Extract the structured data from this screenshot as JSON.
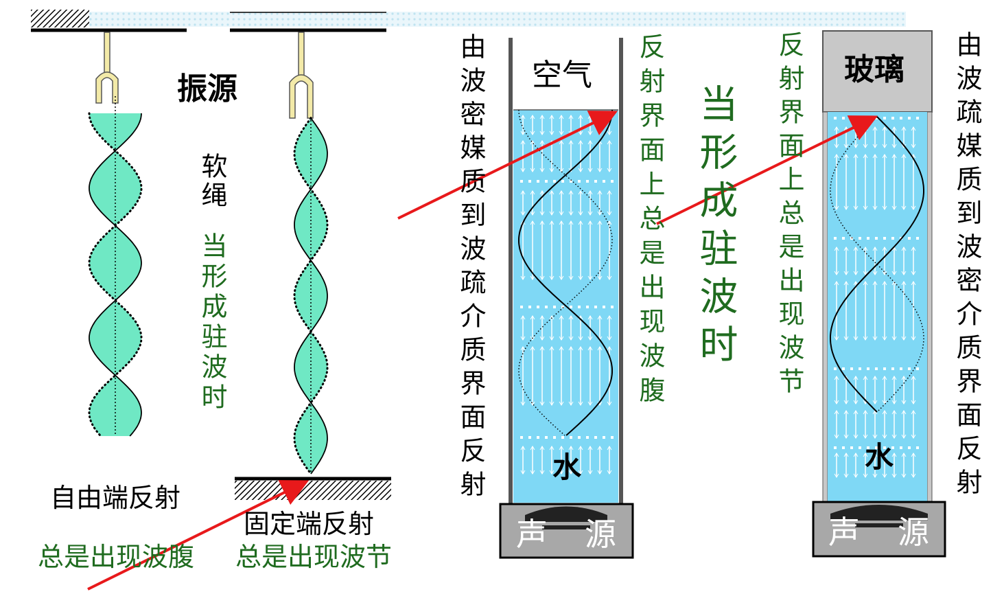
{
  "left_panel": {
    "source_label": "振源",
    "rope_label": "软绳",
    "standing_wave_note": "当形成驻波时",
    "free_end_label": "自由端反射",
    "free_end_result": "总是出现波腹",
    "fixed_end_label": "固定端反射",
    "fixed_end_result": "总是出现波节"
  },
  "tube_air": {
    "top_label": "空气",
    "medium_label": "水",
    "source_label_1": "声",
    "source_label_2": "源",
    "side_note": "由波密媒质到波疏介质界面反射",
    "result_note": "反射界面上总是出现波腹"
  },
  "middle_note": "当形成驻波时",
  "tube_glass": {
    "top_label": "玻璃",
    "medium_label": "水",
    "source_label_1": "声",
    "source_label_2": "源",
    "result_note": "反射界面上总是出现波节",
    "side_note": "由波疏媒质到波密介质界面反射"
  },
  "colors": {
    "water": "#7fd8f5",
    "rope_fill": "#6fe8c4",
    "arrow": "#e8191b",
    "text_green": "#1f6b1f",
    "glass": "#c8c8c8",
    "source_box": "#a8a8a8"
  }
}
